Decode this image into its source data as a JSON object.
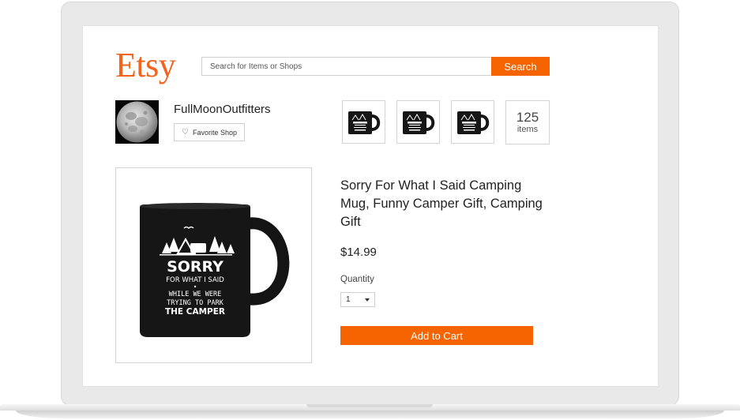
{
  "brand": {
    "logo_text": "Etsy",
    "accent_color": "#f56400"
  },
  "search": {
    "placeholder": "Search for Items or Shops",
    "button_label": "Search"
  },
  "shop": {
    "name": "FullMoonOutfitters",
    "favorite_label": "Favorite Shop",
    "items_count": "125",
    "items_label": "items"
  },
  "product": {
    "title": "Sorry For What I Said Camping Mug, Funny Camper Gift, Camping Gift",
    "price": "$14.99",
    "quantity_label": "Quantity",
    "quantity_value": "1",
    "add_to_cart_label": "Add to Cart",
    "mug_print": {
      "line1": "SORRY",
      "line2": "FOR WHAT I SAID",
      "line3": "WHILE WE WERE",
      "line4": "TRYING TO PARK",
      "line5": "THE CAMPER"
    }
  },
  "icons": [
    "heart-icon",
    "caret-down-icon",
    "moon-avatar-icon"
  ]
}
